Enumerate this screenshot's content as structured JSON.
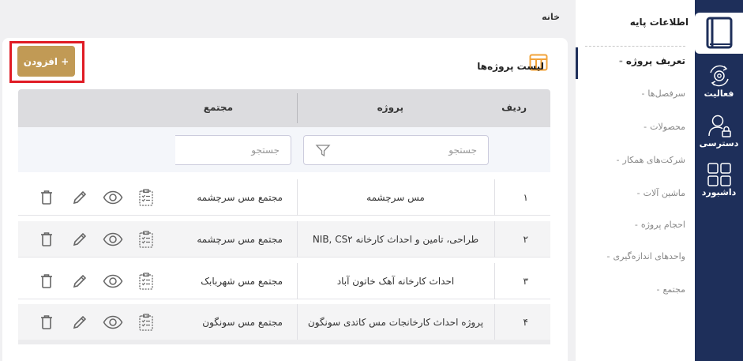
{
  "breadcrumb": {
    "home": "خانه"
  },
  "nav_rail": {
    "items": [
      {
        "label": "",
        "icon": "book-icon",
        "active": true
      },
      {
        "label": "فعالیت",
        "icon": "gear-cycle-icon"
      },
      {
        "label": "دسترسی",
        "icon": "user-lock-icon"
      },
      {
        "label": "داشبورد",
        "icon": "grid-icon"
      }
    ]
  },
  "submenu": {
    "title": "اطلاعات پایه",
    "items": [
      {
        "label": "تعریف پروژه",
        "active": true
      },
      {
        "label": "سرفصل‌ها"
      },
      {
        "label": "محصولات"
      },
      {
        "label": "شرکت‌های همکار"
      },
      {
        "label": "ماشین آلات"
      },
      {
        "label": "احجام پروژه"
      },
      {
        "label": "واحدهای اندازه‌گیری"
      },
      {
        "label": "مجتمع"
      }
    ]
  },
  "page": {
    "list_title": "لیست پروژه‌ها",
    "add_button": "+ افزودن"
  },
  "table": {
    "headers": {
      "index": "ردیف",
      "project": "پروژه",
      "complex": "مجتمع"
    },
    "filters": {
      "project_placeholder": "جستجو",
      "complex_placeholder": "جستجو"
    },
    "rows": [
      {
        "index": "۱",
        "project": "مس سرچشمه",
        "complex": "مجتمع مس سرچشمه"
      },
      {
        "index": "۲",
        "project": "طراحی، تامین و احداث کارخانه NIB, CS۲",
        "complex": "مجتمع مس سرچشمه"
      },
      {
        "index": "۳",
        "project": "احداث کارخانه آهک خاتون آباد",
        "complex": "مجتمع مس شهربابک"
      },
      {
        "index": "۴",
        "project": "پروژه احداث کارخانجات مس کاتدی سونگون",
        "complex": "مجتمع مس سونگون"
      }
    ]
  },
  "colors": {
    "rail": "#1e2f5a",
    "accent": "#c19a55",
    "highlight": "#e01b24",
    "table_icon": "#f2a33a"
  }
}
